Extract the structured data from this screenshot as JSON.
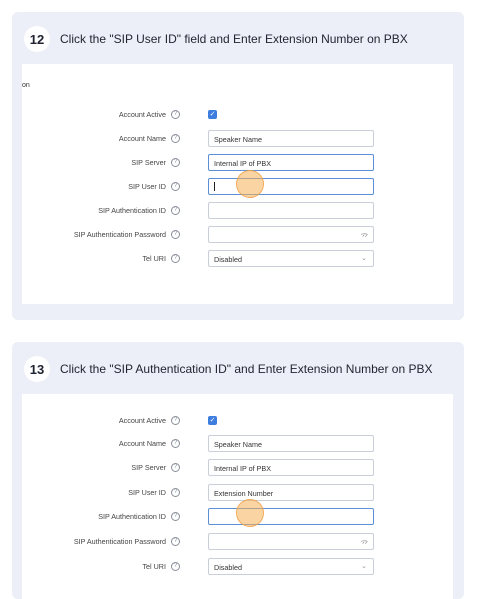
{
  "steps": [
    {
      "number": "12",
      "instruction": "Click the \"SIP User ID\" field and Enter Extension Number on PBX",
      "section_stub": "on",
      "fields": {
        "account_active": {
          "label": "Account Active"
        },
        "account_name": {
          "label": "Account Name",
          "value": "Speaker Name"
        },
        "sip_server": {
          "label": "SIP Server",
          "value": "Internal IP of PBX"
        },
        "sip_user_id": {
          "label": "SIP User ID",
          "value": ""
        },
        "sip_auth_id": {
          "label": "SIP Authentication ID",
          "value": ""
        },
        "sip_auth_password": {
          "label": "SIP Authentication Password",
          "value": ""
        },
        "tel_uri": {
          "label": "Tel URI",
          "value": "Disabled"
        }
      }
    },
    {
      "number": "13",
      "instruction": "Click the \"SIP Authentication ID\" and Enter Extension Number on PBX",
      "section_stub": "",
      "fields": {
        "account_active": {
          "label": "Account Active"
        },
        "account_name": {
          "label": "Account Name",
          "value": "Speaker Name"
        },
        "sip_server": {
          "label": "SIP Server",
          "value": "Internal IP of PBX"
        },
        "sip_user_id": {
          "label": "SIP User ID",
          "value": "Extension Number"
        },
        "sip_auth_id": {
          "label": "SIP Authentication ID",
          "value": ""
        },
        "sip_auth_password": {
          "label": "SIP Authentication Password",
          "value": ""
        },
        "tel_uri": {
          "label": "Tel URI",
          "value": "Disabled"
        }
      }
    }
  ],
  "icons": {
    "help": "?",
    "checkmark": "✓",
    "eye_slash": "ᯄ",
    "chevron_down": "⌄"
  },
  "colors": {
    "card_bg": "#eceff7",
    "checkbox_blue": "#3d7de0",
    "active_border": "#5b8fd6",
    "click_highlight": "#f7b05a"
  }
}
